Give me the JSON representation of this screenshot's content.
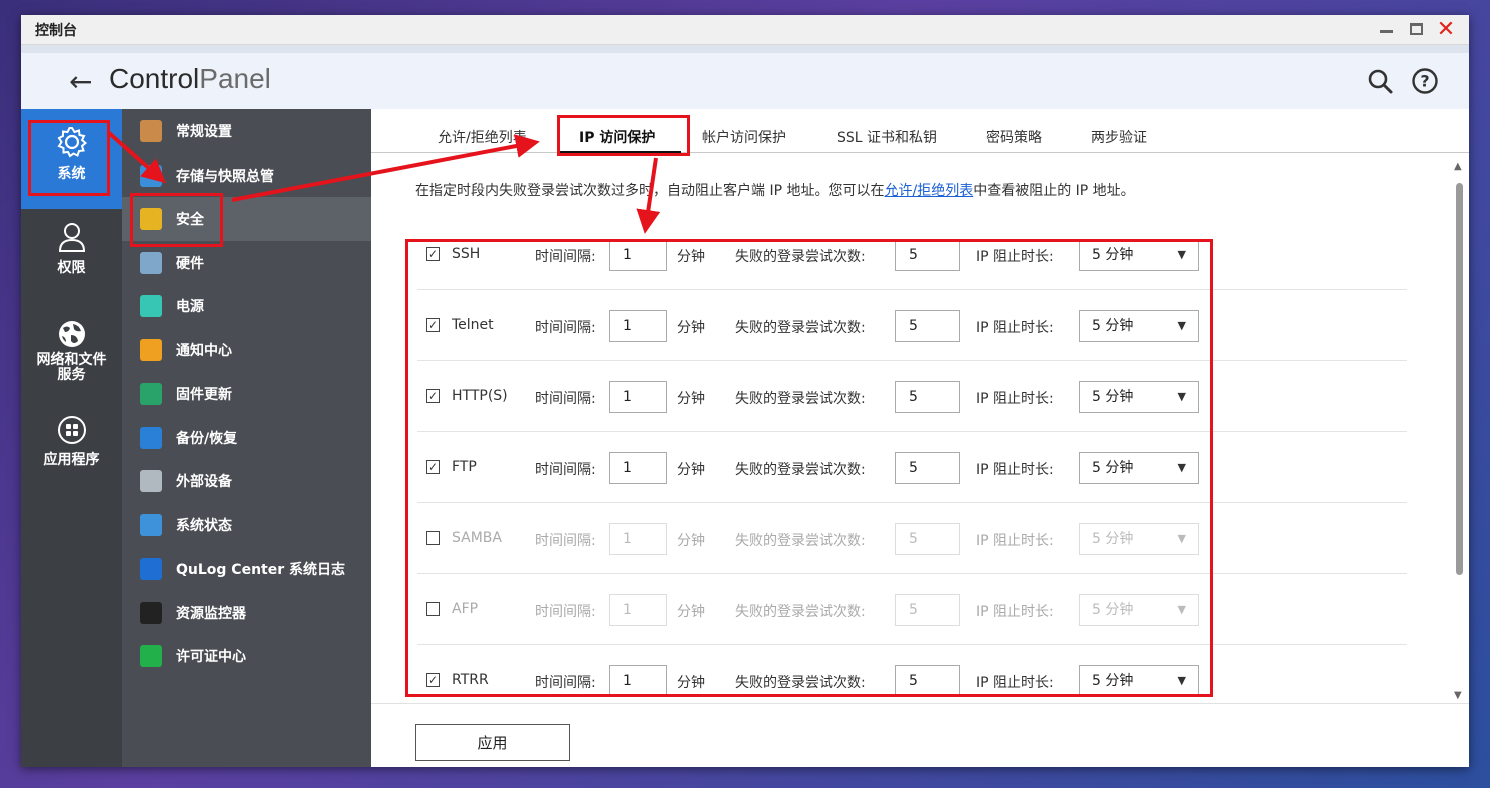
{
  "window": {
    "title": "控制台",
    "app_title_bold": "Control",
    "app_title_light": "Panel"
  },
  "leftbar": {
    "items": [
      {
        "label": "系统",
        "icon": "gear-icon"
      },
      {
        "label": "权限",
        "icon": "user-icon"
      },
      {
        "label": "网络和文件服务",
        "icon": "globe-icon"
      },
      {
        "label": "应用程序",
        "icon": "apps-icon"
      }
    ]
  },
  "midnav": {
    "items": [
      {
        "label": "常规设置",
        "icon": "general-settings-icon",
        "color": "#c98a4a"
      },
      {
        "label": "存储与快照总管",
        "icon": "storage-icon",
        "color": "#3a8fd8"
      },
      {
        "label": "安全",
        "icon": "lock-icon",
        "color": "#e6b422"
      },
      {
        "label": "硬件",
        "icon": "hardware-icon",
        "color": "#7fa7c9"
      },
      {
        "label": "电源",
        "icon": "power-icon",
        "color": "#38c6b4"
      },
      {
        "label": "通知中心",
        "icon": "notification-icon",
        "color": "#f0a020"
      },
      {
        "label": "固件更新",
        "icon": "firmware-icon",
        "color": "#2aa36a"
      },
      {
        "label": "备份/恢复",
        "icon": "backup-icon",
        "color": "#2a7fd6"
      },
      {
        "label": "外部设备",
        "icon": "external-device-icon",
        "color": "#b0b8c0"
      },
      {
        "label": "系统状态",
        "icon": "system-status-icon",
        "color": "#3e92d9"
      },
      {
        "label": "QuLog Center 系统日志",
        "icon": "qulog-icon",
        "color": "#1f6ed4"
      },
      {
        "label": "资源监控器",
        "icon": "resource-monitor-icon",
        "color": "#222222"
      },
      {
        "label": "许可证中心",
        "icon": "license-icon",
        "color": "#22b04a"
      }
    ]
  },
  "tabs": [
    {
      "label": "允许/拒绝列表"
    },
    {
      "label": "IP 访问保护"
    },
    {
      "label": "帐户访问保护"
    },
    {
      "label": "SSL 证书和私钥"
    },
    {
      "label": "密码策略"
    },
    {
      "label": "两步验证"
    }
  ],
  "desc": {
    "before": "在指定时段内失败登录尝试次数过多时，自动阻止客户端 IP 地址。您可以在",
    "link": "允许/拒绝列表",
    "after": "中查看被阻止的 IP 地址。"
  },
  "labels": {
    "interval": "时间间隔:",
    "minutes": "分钟",
    "attempts": "失败的登录尝试次数:",
    "block": "IP 阻止时长:"
  },
  "rows": [
    {
      "name": "SSH",
      "checked": true,
      "interval": "1",
      "attempts": "5",
      "block": "5 分钟"
    },
    {
      "name": "Telnet",
      "checked": true,
      "interval": "1",
      "attempts": "5",
      "block": "5 分钟"
    },
    {
      "name": "HTTP(S)",
      "checked": true,
      "interval": "1",
      "attempts": "5",
      "block": "5 分钟"
    },
    {
      "name": "FTP",
      "checked": true,
      "interval": "1",
      "attempts": "5",
      "block": "5 分钟"
    },
    {
      "name": "SAMBA",
      "checked": false,
      "interval": "1",
      "attempts": "5",
      "block": "5 分钟"
    },
    {
      "name": "AFP",
      "checked": false,
      "interval": "1",
      "attempts": "5",
      "block": "5 分钟"
    },
    {
      "name": "RTRR",
      "checked": true,
      "interval": "1",
      "attempts": "5",
      "block": "5 分钟"
    }
  ],
  "footer": {
    "apply": "应用"
  },
  "colors": {
    "accent": "#2a79d6",
    "annotation": "#e5141c"
  }
}
